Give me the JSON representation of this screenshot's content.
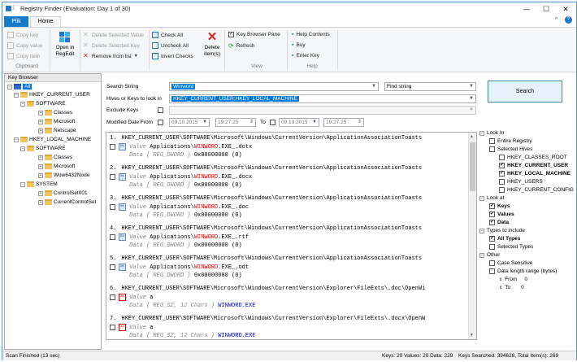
{
  "window": {
    "title": "Registry Finder (Evaluation: Day 1 of 30)",
    "minimize": "—",
    "maximize": "☐",
    "close": "✕",
    "help_icon": "?",
    "collapse_icon": "^"
  },
  "tabs": {
    "file": "Plik",
    "home": "Home"
  },
  "ribbon": {
    "clipboard": {
      "copy_key": "Copy key",
      "copy_value": "Copy value",
      "copy_item": "Copy item",
      "group": "Clipboard"
    },
    "open_in_regedit": [
      "Open in",
      "RegEdit"
    ],
    "delete_selected_value": "Delete Selected Value",
    "delete_selected_key": "Delete Selected Key",
    "remove_from_list": "Remove from list",
    "check_all": "Check All",
    "uncheck_all": "Uncheck All",
    "invert_checks": "Invert Checks",
    "delete_items": [
      "Delete",
      "item(s)"
    ],
    "key_browser_pane": "Key Browser Pane",
    "refresh": "Refresh",
    "view_group": "View",
    "help_contents": "Help Contents",
    "buy": "Buy",
    "enter_key": "Enter Key",
    "help_group": "Help"
  },
  "key_browser": {
    "title": "Key Browser",
    "nodes": [
      "All",
      "HKEY_CURRENT_USER",
      "SOFTWARE",
      "Classes",
      "Microsoft",
      "Netscape",
      "HKEY_LOCAL_MACHINE",
      "SOFTWARE",
      "Classes",
      "Microsoft",
      "Wow6432Node",
      "SYSTEM",
      "ControlSet001",
      "CurrentControlSet"
    ]
  },
  "search": {
    "search_string_label": "Search String",
    "search_string": "Winword",
    "mode": "Find string",
    "hives_label": "Hives or Keys to look in",
    "hives": "HKEY_CURRENT_USER;HKEY_LOCAL_MACHINE",
    "exclude_label": "Exclude Keys",
    "modified_label": "Modified Date From",
    "date_from": "09.10.2015",
    "time_from": "19:27:25",
    "to_label": "To",
    "date_to": "09.10.2015",
    "time_to": "19:27:25",
    "button": "Search"
  },
  "results": [
    {
      "n": "1.",
      "path": "HKEY_CURRENT_USER\\SOFTWARE\\Microsoft\\Windows\\CurrentVersion\\ApplicationAssociationToasts",
      "vpre": "Applications\\",
      "vmatch": "WINWORD",
      "vpost": ".EXE_.dotx",
      "dtype": "{ REG_DWORD }",
      "dval": "0x00000000 (0)"
    },
    {
      "n": "2.",
      "path": "HKEY_CURRENT_USER\\SOFTWARE\\Microsoft\\Windows\\CurrentVersion\\ApplicationAssociationToasts",
      "vpre": "Applications\\",
      "vmatch": "WINWORD",
      "vpost": ".EXE_.docx",
      "dtype": "{ REG_DWORD }",
      "dval": "0x00000000 (0)"
    },
    {
      "n": "3.",
      "path": "HKEY_CURRENT_USER\\SOFTWARE\\Microsoft\\Windows\\CurrentVersion\\ApplicationAssociationToasts",
      "vpre": "Applications\\",
      "vmatch": "WINWORD",
      "vpost": ".EXE_.doc",
      "dtype": "{ REG_DWORD }",
      "dval": "0x00000000 (0)"
    },
    {
      "n": "4.",
      "path": "HKEY_CURRENT_USER\\SOFTWARE\\Microsoft\\Windows\\CurrentVersion\\ApplicationAssociationToasts",
      "vpre": "Applications\\",
      "vmatch": "WINWORD",
      "vpost": ".EXE_.rtf",
      "dtype": "{ REG_DWORD }",
      "dval": "0x00000000 (0)"
    },
    {
      "n": "5.",
      "path": "HKEY_CURRENT_USER\\SOFTWARE\\Microsoft\\Windows\\CurrentVersion\\ApplicationAssociationToasts",
      "vpre": "Applications\\",
      "vmatch": "WINWORD",
      "vpost": ".EXE_.odt",
      "dtype": "{ REG_DWORD }",
      "dval": "0x00000000 (0)"
    },
    {
      "n": "6.",
      "path": "HKEY_CURRENT_USER\\SOFTWARE\\Microsoft\\Windows\\CurrentVersion\\Explorer\\FileExts\\.doc\\OpenWi",
      "vpre": "a",
      "vmatch": "",
      "vpost": "",
      "dtype": "{ REG_SZ, 12 Chars }",
      "dval": "WINWORD.EXE"
    },
    {
      "n": "7.",
      "path": "HKEY_CURRENT_USER\\SOFTWARE\\Microsoft\\Windows\\CurrentVersion\\Explorer\\FileExts\\.docx\\OpenW",
      "vpre": "a",
      "vmatch": "",
      "vpost": "",
      "dtype": "{ REG_SZ, 12 Chars }",
      "dval": "WINWORD.EXE"
    }
  ],
  "labels": {
    "value": "Value",
    "data": "Data"
  },
  "options": {
    "look_in": "Look In",
    "entire_registry": "Entire Registry",
    "selected_hives": "Selected Hives",
    "hkcr": "HKEY_CLASSES_ROOT",
    "hkcu": "HKEY_CURRENT_USER",
    "hklm": "HKEY_LOCAL_MACHINE",
    "hku": "HKEY_USERS",
    "hkcc": "HKEY_CURRENT_CONFIG",
    "look_at": "Look at",
    "keys": "Keys",
    "values": "Values",
    "data": "Data",
    "types": "Types to include",
    "all_types": "All Types",
    "selected_types": "Selected Types",
    "other": "Other",
    "case_sensitive": "Case Sensitive",
    "data_length": "Data length range (bytes)",
    "from": "From",
    "from_val": "0",
    "to": "To",
    "to_val": "0"
  },
  "status": {
    "left": "Scan Finished (13 sec)",
    "mid": "Keys: 20 Values: 20 Data: 229",
    "right": "Keys Searched: 394628, Total Item(s): 269"
  },
  "colors": {
    "accent": "#1979ca",
    "selection": "#0078d7",
    "match": "#dd0000",
    "data_value": "#0000cc"
  }
}
